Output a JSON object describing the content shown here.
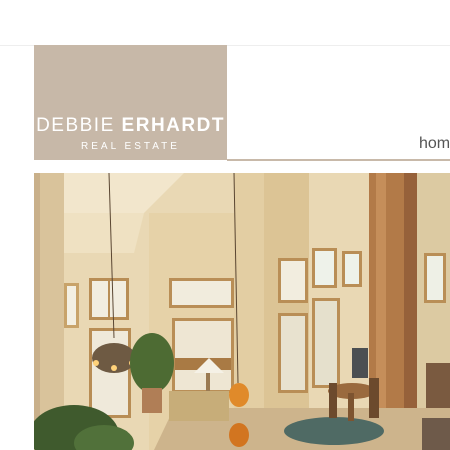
{
  "logo": {
    "first_name": "DEBBIE",
    "last_name": "ERHARDT",
    "tagline": "REAL ESTATE"
  },
  "nav": {
    "items": [
      {
        "label": "home"
      }
    ]
  },
  "colors": {
    "logo_background": "#c7b8a8",
    "logo_text": "#ffffff",
    "rule": "#c8b9a9",
    "nav_text": "#555555"
  }
}
